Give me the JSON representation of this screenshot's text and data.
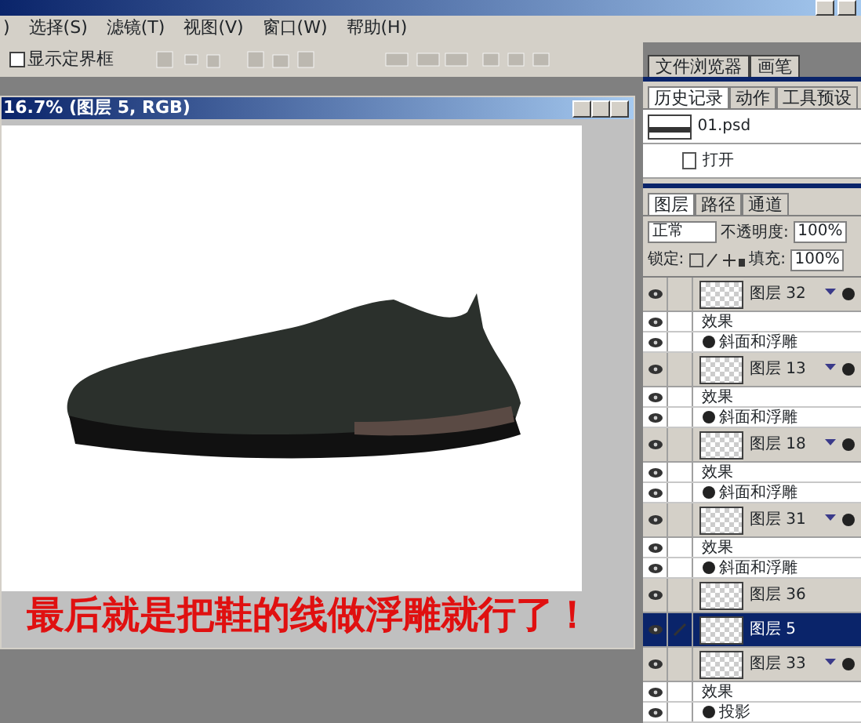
{
  "menu": [
    {
      "label": ")"
    },
    {
      "label": "选择(S)"
    },
    {
      "label": "滤镜(T)"
    },
    {
      "label": "视图(V)"
    },
    {
      "label": "窗口(W)"
    },
    {
      "label": "帮助(H)"
    }
  ],
  "options_bar": {
    "show_bounds": {
      "label": "显示定界框",
      "checked": false
    }
  },
  "panel_well_tabs": [
    {
      "label": "文件浏览器",
      "selected": false
    },
    {
      "label": "画笔",
      "selected": false
    }
  ],
  "document": {
    "title": "16.7% (图层 5, RGB)",
    "caption": "最后就是把鞋的线做浮雕就行了！"
  },
  "history_panel": {
    "tabs": [
      {
        "label": "历史记录",
        "selected": true
      },
      {
        "label": "动作",
        "selected": false
      },
      {
        "label": "工具预设",
        "selected": false
      }
    ],
    "snapshot": "01.psd",
    "steps": [
      {
        "label": "打开",
        "selected": false
      }
    ]
  },
  "layers_panel": {
    "tabs": [
      {
        "label": "图层",
        "selected": true
      },
      {
        "label": "路径",
        "selected": false
      },
      {
        "label": "通道",
        "selected": false
      }
    ],
    "blend_mode": "正常",
    "opacity_label": "不透明度:",
    "opacity": "100%",
    "lock_label": "锁定:",
    "fill_label": "填充:",
    "fill": "100%",
    "layers": [
      {
        "name": "图层 32",
        "visible": true,
        "selected": false,
        "effects_label": "效果",
        "effects": [
          "斜面和浮雕"
        ]
      },
      {
        "name": "图层 13",
        "visible": true,
        "selected": false,
        "effects_label": "效果",
        "effects": [
          "斜面和浮雕"
        ]
      },
      {
        "name": "图层 18",
        "visible": true,
        "selected": false,
        "effects_label": "效果",
        "effects": [
          "斜面和浮雕"
        ]
      },
      {
        "name": "图层 31",
        "visible": true,
        "selected": false,
        "effects_label": "效果",
        "effects": [
          "斜面和浮雕"
        ]
      },
      {
        "name": "图层 36",
        "visible": true,
        "selected": false
      },
      {
        "name": "图层 5",
        "visible": true,
        "selected": true
      },
      {
        "name": "图层 33",
        "visible": true,
        "selected": false,
        "effects_label": "效果",
        "effects": [
          "投影"
        ]
      }
    ]
  }
}
